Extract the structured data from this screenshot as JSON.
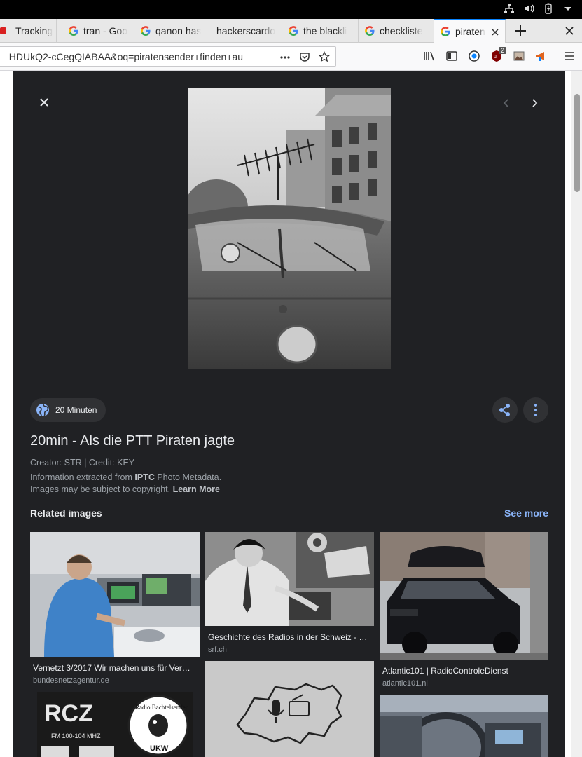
{
  "tabs": [
    {
      "label": "Tracking",
      "icon": "red-tab-icon"
    },
    {
      "label": "tran - Goo",
      "icon": "google-icon"
    },
    {
      "label": "qanon has",
      "icon": "google-icon"
    },
    {
      "label": "hackerscardo",
      "icon": "none"
    },
    {
      "label": "the blackli",
      "icon": "google-icon"
    },
    {
      "label": "checkliste",
      "icon": "google-icon"
    },
    {
      "label": "piraten",
      "icon": "google-icon",
      "active": true
    }
  ],
  "url": "_HDUkQ2-cCegQIABAA&oq=piratensender+finden+au",
  "extension_badge": "2",
  "viewer": {
    "source": "20 Minuten",
    "title": "20min - Als die PTT Piraten jagte",
    "creator_line": "Creator: STR | Credit: KEY",
    "info_prefix": "Information extracted from ",
    "info_bold": "IPTC",
    "info_suffix": " Photo Metadata.",
    "copyright_text": "Images may be subject to copyright. ",
    "learn_more": "Learn More",
    "related_heading": "Related images",
    "see_more": "See more"
  },
  "related": [
    {
      "caption": "Vernetzt 3/2017 Wir machen uns für Ver…",
      "domain": "bundesnetzagentur.de"
    },
    {
      "caption": "Geschichte des Radios in der Schweiz - …",
      "domain": "srf.ch"
    },
    {
      "caption": "Atlantic101 | RadioControleDienst",
      "domain": "atlantic101.nl"
    }
  ],
  "logo_text": {
    "rc_letters": "RCZ",
    "rc_freq": "FM 100-104 MHZ",
    "bachtel": "Radio Bachtelsender",
    "ukw": "UKW"
  },
  "colors": {
    "panel_bg": "#202124",
    "link_blue": "#8ab4f8",
    "tab_accent": "#0a84ff"
  }
}
